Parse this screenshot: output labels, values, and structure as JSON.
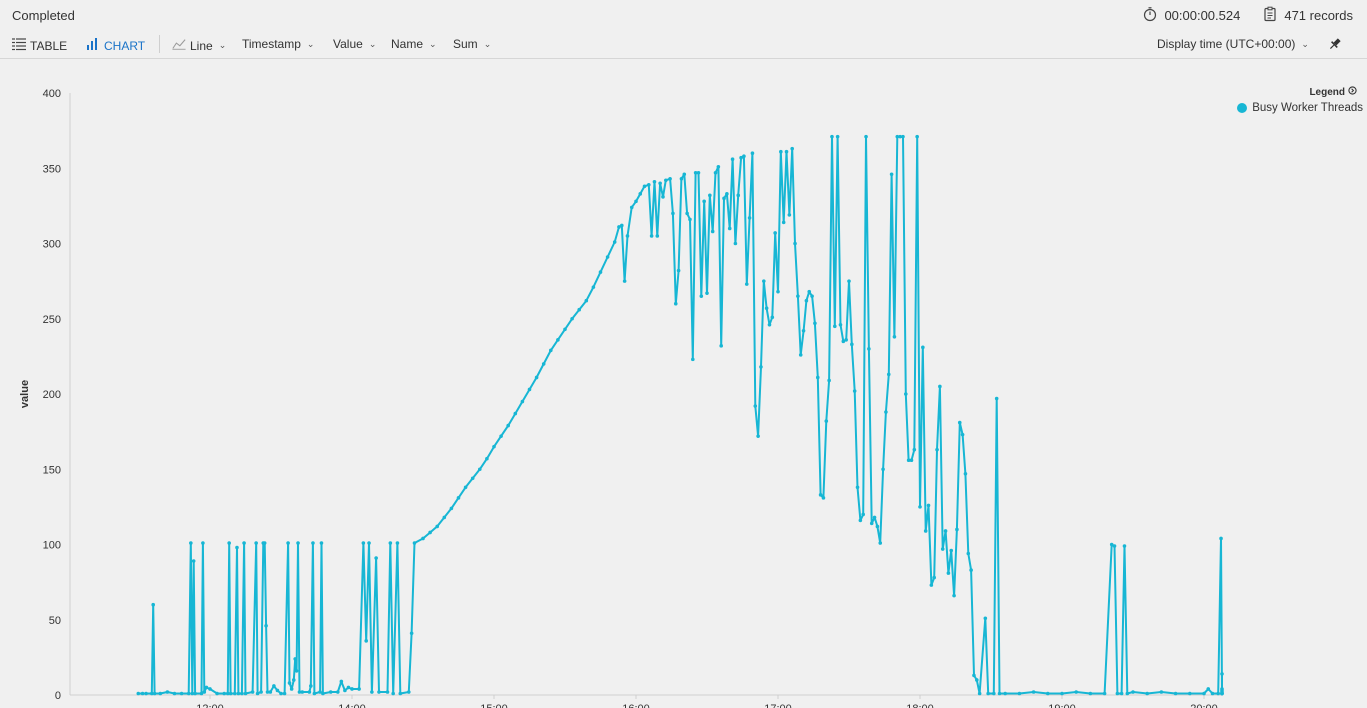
{
  "status": "Completed",
  "duration": "00:00:00.524",
  "records": "471 records",
  "toolbar": {
    "table": "TABLE",
    "chart": "CHART",
    "line": "Line",
    "timestamp": "Timestamp",
    "value": "Value",
    "name": "Name",
    "sum": "Sum",
    "display_time": "Display time (UTC+00:00)"
  },
  "legend": {
    "title": "Legend",
    "series": "Busy Worker Threads"
  },
  "colors": {
    "series": "#17b6d4",
    "accent": "#1a73c8"
  },
  "chart_data": {
    "type": "line",
    "ylabel": "value",
    "xlabel": "",
    "ylim": [
      0,
      400
    ],
    "yticks": [
      0,
      50,
      100,
      150,
      200,
      250,
      300,
      350,
      400
    ],
    "xlim": [
      10.98,
      20.2
    ],
    "xticks": [
      "12:00",
      "14:00",
      "15:00",
      "16:00",
      "17:00",
      "18:00",
      "19:00",
      "20:00"
    ],
    "xtick_values": [
      12,
      14,
      15,
      16,
      17,
      18,
      19,
      20
    ],
    "series": [
      {
        "name": "Busy Worker Threads",
        "points": [
          [
            10.99,
            1
          ],
          [
            11.05,
            1
          ],
          [
            11.1,
            1
          ],
          [
            11.18,
            1
          ],
          [
            11.2,
            60
          ],
          [
            11.22,
            1
          ],
          [
            11.3,
            1
          ],
          [
            11.4,
            2
          ],
          [
            11.5,
            1
          ],
          [
            11.6,
            1
          ],
          [
            11.7,
            1
          ],
          [
            11.73,
            101
          ],
          [
            11.75,
            1
          ],
          [
            11.77,
            89
          ],
          [
            11.79,
            1
          ],
          [
            11.88,
            1
          ],
          [
            11.9,
            101
          ],
          [
            11.92,
            2
          ],
          [
            11.95,
            5
          ],
          [
            12.0,
            4
          ],
          [
            12.1,
            1
          ],
          [
            12.2,
            1
          ],
          [
            12.25,
            1
          ],
          [
            12.27,
            101
          ],
          [
            12.29,
            1
          ],
          [
            12.35,
            1
          ],
          [
            12.38,
            98
          ],
          [
            12.4,
            1
          ],
          [
            12.45,
            1
          ],
          [
            12.48,
            101
          ],
          [
            12.5,
            1
          ],
          [
            12.6,
            2
          ],
          [
            12.65,
            101
          ],
          [
            12.67,
            1
          ],
          [
            12.72,
            2
          ],
          [
            12.75,
            101
          ],
          [
            12.77,
            101
          ],
          [
            12.79,
            46
          ],
          [
            12.81,
            2
          ],
          [
            12.85,
            2
          ],
          [
            12.9,
            6
          ],
          [
            12.95,
            3
          ],
          [
            13.0,
            1
          ],
          [
            13.05,
            1
          ],
          [
            13.1,
            101
          ],
          [
            13.12,
            8
          ],
          [
            13.15,
            4
          ],
          [
            13.18,
            10
          ],
          [
            13.2,
            24
          ],
          [
            13.22,
            16
          ],
          [
            13.24,
            101
          ],
          [
            13.26,
            2
          ],
          [
            13.3,
            2
          ],
          [
            13.4,
            2
          ],
          [
            13.42,
            6
          ],
          [
            13.45,
            101
          ],
          [
            13.47,
            1
          ],
          [
            13.55,
            2
          ],
          [
            13.57,
            101
          ],
          [
            13.59,
            1
          ],
          [
            13.7,
            2
          ],
          [
            13.8,
            2
          ],
          [
            13.85,
            9
          ],
          [
            13.9,
            3
          ],
          [
            13.95,
            5
          ],
          [
            14.0,
            4
          ],
          [
            14.05,
            4
          ],
          [
            14.08,
            101
          ],
          [
            14.1,
            36
          ],
          [
            14.12,
            101
          ],
          [
            14.14,
            2
          ],
          [
            14.17,
            91
          ],
          [
            14.19,
            2
          ],
          [
            14.25,
            2
          ],
          [
            14.27,
            101
          ],
          [
            14.29,
            1
          ],
          [
            14.32,
            101
          ],
          [
            14.34,
            1
          ],
          [
            14.4,
            2
          ],
          [
            14.42,
            41
          ],
          [
            14.44,
            101
          ],
          [
            14.5,
            104
          ],
          [
            14.55,
            108
          ],
          [
            14.6,
            112
          ],
          [
            14.65,
            118
          ],
          [
            14.7,
            124
          ],
          [
            14.75,
            131
          ],
          [
            14.8,
            138
          ],
          [
            14.85,
            144
          ],
          [
            14.9,
            150
          ],
          [
            14.95,
            157
          ],
          [
            15.0,
            165
          ],
          [
            15.05,
            172
          ],
          [
            15.1,
            179
          ],
          [
            15.15,
            187
          ],
          [
            15.2,
            195
          ],
          [
            15.25,
            203
          ],
          [
            15.3,
            211
          ],
          [
            15.35,
            220
          ],
          [
            15.4,
            229
          ],
          [
            15.45,
            236
          ],
          [
            15.5,
            243
          ],
          [
            15.55,
            250
          ],
          [
            15.6,
            256
          ],
          [
            15.65,
            262
          ],
          [
            15.7,
            271
          ],
          [
            15.75,
            281
          ],
          [
            15.8,
            291
          ],
          [
            15.85,
            301
          ],
          [
            15.88,
            311
          ],
          [
            15.9,
            312
          ],
          [
            15.92,
            275
          ],
          [
            15.94,
            305
          ],
          [
            15.97,
            324
          ],
          [
            16.0,
            328
          ],
          [
            16.03,
            333
          ],
          [
            16.06,
            338
          ],
          [
            16.09,
            339
          ],
          [
            16.11,
            305
          ],
          [
            16.13,
            341
          ],
          [
            16.15,
            305
          ],
          [
            16.17,
            340
          ],
          [
            16.19,
            331
          ],
          [
            16.21,
            342
          ],
          [
            16.24,
            343
          ],
          [
            16.26,
            320
          ],
          [
            16.28,
            260
          ],
          [
            16.3,
            282
          ],
          [
            16.32,
            343
          ],
          [
            16.34,
            346
          ],
          [
            16.36,
            320
          ],
          [
            16.38,
            316
          ],
          [
            16.4,
            223
          ],
          [
            16.42,
            347
          ],
          [
            16.44,
            347
          ],
          [
            16.46,
            265
          ],
          [
            16.48,
            328
          ],
          [
            16.5,
            267
          ],
          [
            16.52,
            332
          ],
          [
            16.54,
            308
          ],
          [
            16.56,
            347
          ],
          [
            16.58,
            351
          ],
          [
            16.6,
            232
          ],
          [
            16.62,
            330
          ],
          [
            16.64,
            333
          ],
          [
            16.66,
            310
          ],
          [
            16.68,
            356
          ],
          [
            16.7,
            300
          ],
          [
            16.72,
            332
          ],
          [
            16.74,
            357
          ],
          [
            16.76,
            358
          ],
          [
            16.78,
            273
          ],
          [
            16.8,
            317
          ],
          [
            16.82,
            360
          ],
          [
            16.84,
            192
          ],
          [
            16.86,
            172
          ],
          [
            16.88,
            218
          ],
          [
            16.9,
            275
          ],
          [
            16.92,
            257
          ],
          [
            16.94,
            246
          ],
          [
            16.96,
            251
          ],
          [
            16.98,
            307
          ],
          [
            17.0,
            268
          ],
          [
            17.02,
            361
          ],
          [
            17.04,
            314
          ],
          [
            17.06,
            361
          ],
          [
            17.08,
            319
          ],
          [
            17.1,
            363
          ],
          [
            17.12,
            300
          ],
          [
            17.14,
            265
          ],
          [
            17.16,
            226
          ],
          [
            17.18,
            242
          ],
          [
            17.2,
            262
          ],
          [
            17.22,
            268
          ],
          [
            17.24,
            265
          ],
          [
            17.26,
            247
          ],
          [
            17.28,
            211
          ],
          [
            17.3,
            133
          ],
          [
            17.32,
            131
          ],
          [
            17.34,
            182
          ],
          [
            17.36,
            209
          ],
          [
            17.38,
            371
          ],
          [
            17.4,
            245
          ],
          [
            17.42,
            371
          ],
          [
            17.44,
            246
          ],
          [
            17.46,
            235
          ],
          [
            17.48,
            236
          ],
          [
            17.5,
            275
          ],
          [
            17.52,
            233
          ],
          [
            17.54,
            202
          ],
          [
            17.56,
            138
          ],
          [
            17.58,
            116
          ],
          [
            17.6,
            120
          ],
          [
            17.62,
            371
          ],
          [
            17.64,
            230
          ],
          [
            17.66,
            114
          ],
          [
            17.68,
            118
          ],
          [
            17.7,
            112
          ],
          [
            17.72,
            101
          ],
          [
            17.74,
            150
          ],
          [
            17.76,
            188
          ],
          [
            17.78,
            213
          ],
          [
            17.8,
            346
          ],
          [
            17.82,
            238
          ],
          [
            17.84,
            371
          ],
          [
            17.86,
            371
          ],
          [
            17.88,
            371
          ],
          [
            17.9,
            200
          ],
          [
            17.92,
            156
          ],
          [
            17.94,
            156
          ],
          [
            17.96,
            163
          ],
          [
            17.98,
            371
          ],
          [
            18.0,
            125
          ],
          [
            18.02,
            231
          ],
          [
            18.04,
            109
          ],
          [
            18.06,
            126
          ],
          [
            18.08,
            73
          ],
          [
            18.1,
            78
          ],
          [
            18.12,
            163
          ],
          [
            18.14,
            205
          ],
          [
            18.16,
            97
          ],
          [
            18.18,
            109
          ],
          [
            18.2,
            81
          ],
          [
            18.22,
            96
          ],
          [
            18.24,
            66
          ],
          [
            18.26,
            110
          ],
          [
            18.28,
            181
          ],
          [
            18.3,
            173
          ],
          [
            18.32,
            147
          ],
          [
            18.34,
            94
          ],
          [
            18.36,
            83
          ],
          [
            18.38,
            13
          ],
          [
            18.4,
            10
          ],
          [
            18.42,
            1
          ],
          [
            18.46,
            51
          ],
          [
            18.48,
            1
          ],
          [
            18.52,
            1
          ],
          [
            18.54,
            197
          ],
          [
            18.56,
            1
          ],
          [
            18.6,
            1
          ],
          [
            18.7,
            1
          ],
          [
            18.8,
            2
          ],
          [
            18.9,
            1
          ],
          [
            19.0,
            1
          ],
          [
            19.1,
            2
          ],
          [
            19.2,
            1
          ],
          [
            19.3,
            1
          ],
          [
            19.35,
            100
          ],
          [
            19.37,
            99
          ],
          [
            19.39,
            1
          ],
          [
            19.42,
            1
          ],
          [
            19.44,
            99
          ],
          [
            19.46,
            1
          ],
          [
            19.5,
            2
          ],
          [
            19.6,
            1
          ],
          [
            19.7,
            2
          ],
          [
            19.8,
            1
          ],
          [
            19.9,
            1
          ],
          [
            20.0,
            1
          ],
          [
            20.03,
            4
          ],
          [
            20.06,
            1
          ],
          [
            20.1,
            1
          ],
          [
            20.12,
            104
          ],
          [
            20.14,
            1
          ],
          [
            20.2,
            1
          ],
          [
            20.3,
            1
          ],
          [
            20.4,
            1
          ],
          [
            20.5,
            2
          ],
          [
            20.55,
            14
          ],
          [
            20.57,
            4
          ],
          [
            20.59,
            3
          ]
        ]
      }
    ]
  }
}
